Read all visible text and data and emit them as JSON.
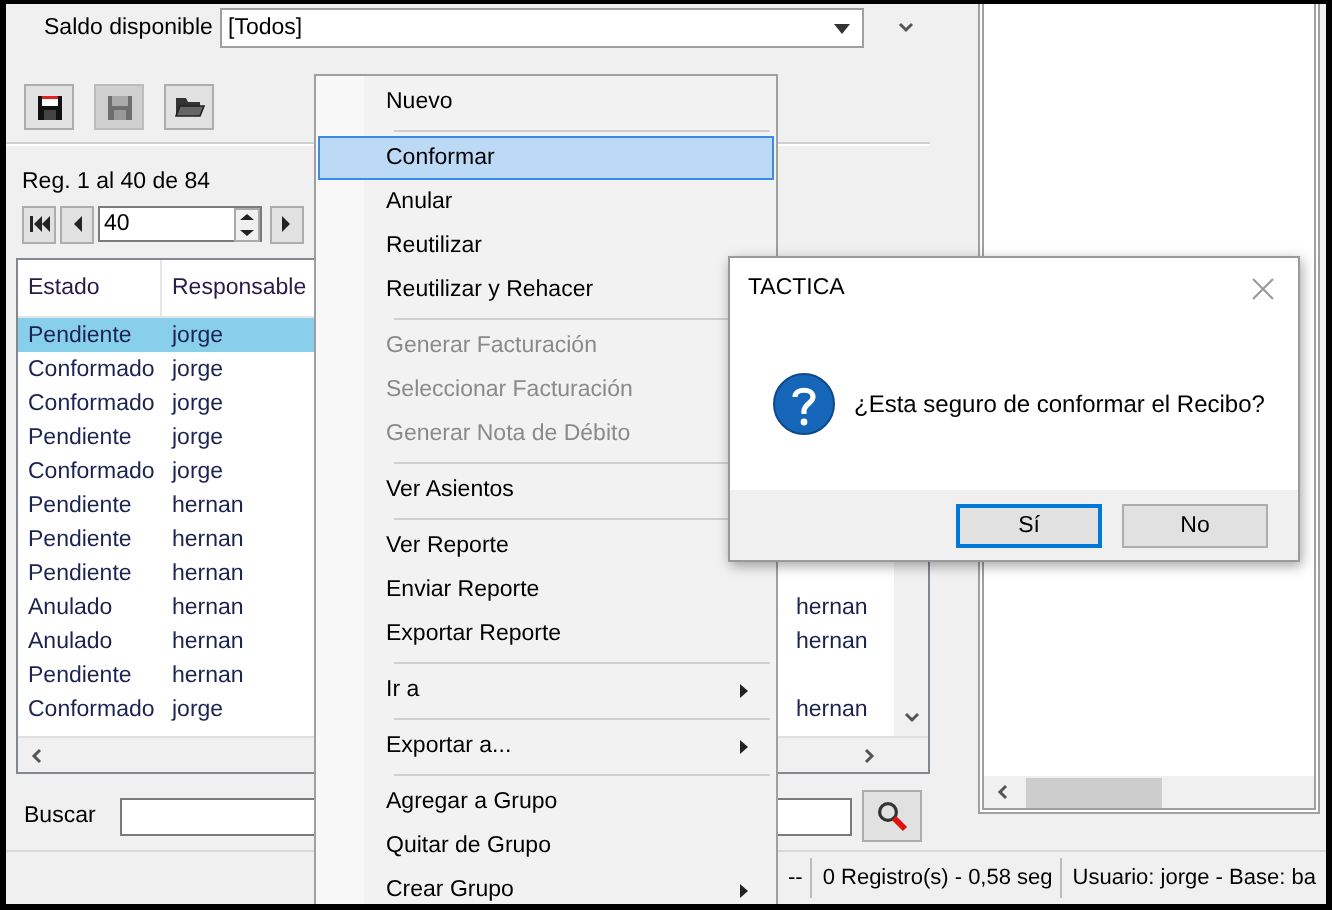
{
  "filter": {
    "label": "Saldo disponible",
    "value": "[Todos]"
  },
  "toolbar": [
    {
      "kind": "save",
      "disabled": false
    },
    {
      "kind": "save",
      "disabled": true
    },
    {
      "kind": "open",
      "disabled": false
    }
  ],
  "records_label": "Reg. 1 al 40 de 84",
  "pager": {
    "value": "40"
  },
  "table": {
    "columns": [
      "Estado",
      "Responsable"
    ],
    "rows": [
      {
        "cells": [
          "Pendiente",
          "jorge"
        ],
        "selected": true
      },
      {
        "cells": [
          "Conformado",
          "jorge"
        ],
        "selected": false
      },
      {
        "cells": [
          "Conformado",
          "jorge"
        ],
        "selected": false
      },
      {
        "cells": [
          "Pendiente",
          "jorge"
        ],
        "selected": false
      },
      {
        "cells": [
          "Conformado",
          "jorge"
        ],
        "selected": false
      },
      {
        "cells": [
          "Pendiente",
          "hernan"
        ],
        "selected": false
      },
      {
        "cells": [
          "Pendiente",
          "hernan"
        ],
        "selected": false
      },
      {
        "cells": [
          "Pendiente",
          "hernan"
        ],
        "selected": false
      },
      {
        "cells": [
          "Anulado",
          "hernan",
          "hernan"
        ],
        "selected": false
      },
      {
        "cells": [
          "Anulado",
          "hernan",
          "hernan"
        ],
        "selected": false
      },
      {
        "cells": [
          "Pendiente",
          "hernan"
        ],
        "selected": false
      },
      {
        "cells": [
          "Conformado",
          "jorge",
          "hernan"
        ],
        "selected": false
      }
    ]
  },
  "search": {
    "label": "Buscar"
  },
  "status_bar": [
    "--",
    "0 Registro(s) - 0,58 seg",
    "Usuario: jorge - Base: ba"
  ],
  "context_menu": {
    "items": [
      {
        "kind": "item",
        "label": "Nuevo",
        "selected": false,
        "disabled": false,
        "submenu": false
      },
      {
        "kind": "separator"
      },
      {
        "kind": "item",
        "label": "Conformar",
        "selected": true,
        "disabled": false,
        "submenu": false
      },
      {
        "kind": "item",
        "label": "Anular",
        "selected": false,
        "disabled": false,
        "submenu": false
      },
      {
        "kind": "item",
        "label": "Reutilizar",
        "selected": false,
        "disabled": false,
        "submenu": false
      },
      {
        "kind": "item",
        "label": "Reutilizar y Rehacer",
        "selected": false,
        "disabled": false,
        "submenu": false
      },
      {
        "kind": "separator"
      },
      {
        "kind": "item",
        "label": "Generar Facturación",
        "selected": false,
        "disabled": true,
        "submenu": false
      },
      {
        "kind": "item",
        "label": "Seleccionar Facturación",
        "selected": false,
        "disabled": true,
        "submenu": false
      },
      {
        "kind": "item",
        "label": "Generar Nota de Débito",
        "selected": false,
        "disabled": true,
        "submenu": false
      },
      {
        "kind": "separator"
      },
      {
        "kind": "item",
        "label": "Ver Asientos",
        "selected": false,
        "disabled": false,
        "submenu": false
      },
      {
        "kind": "separator"
      },
      {
        "kind": "item",
        "label": "Ver Reporte",
        "selected": false,
        "disabled": false,
        "submenu": false
      },
      {
        "kind": "item",
        "label": "Enviar Reporte",
        "selected": false,
        "disabled": false,
        "submenu": false
      },
      {
        "kind": "item",
        "label": "Exportar Reporte",
        "selected": false,
        "disabled": false,
        "submenu": false
      },
      {
        "kind": "separator"
      },
      {
        "kind": "item",
        "label": "Ir a",
        "selected": false,
        "disabled": false,
        "submenu": true
      },
      {
        "kind": "separator"
      },
      {
        "kind": "item",
        "label": "Exportar a...",
        "selected": false,
        "disabled": false,
        "submenu": true
      },
      {
        "kind": "separator"
      },
      {
        "kind": "item",
        "label": "Agregar a Grupo",
        "selected": false,
        "disabled": false,
        "submenu": false
      },
      {
        "kind": "item",
        "label": "Quitar de Grupo",
        "selected": false,
        "disabled": false,
        "submenu": false
      },
      {
        "kind": "item",
        "label": "Crear Grupo",
        "selected": false,
        "disabled": false,
        "submenu": true
      }
    ]
  },
  "dialog": {
    "title": "TACTICA",
    "message": "¿Esta seguro de conformar el Recibo?",
    "buttons": [
      {
        "label": "Sí",
        "default": true
      },
      {
        "label": "No",
        "default": false
      }
    ]
  }
}
